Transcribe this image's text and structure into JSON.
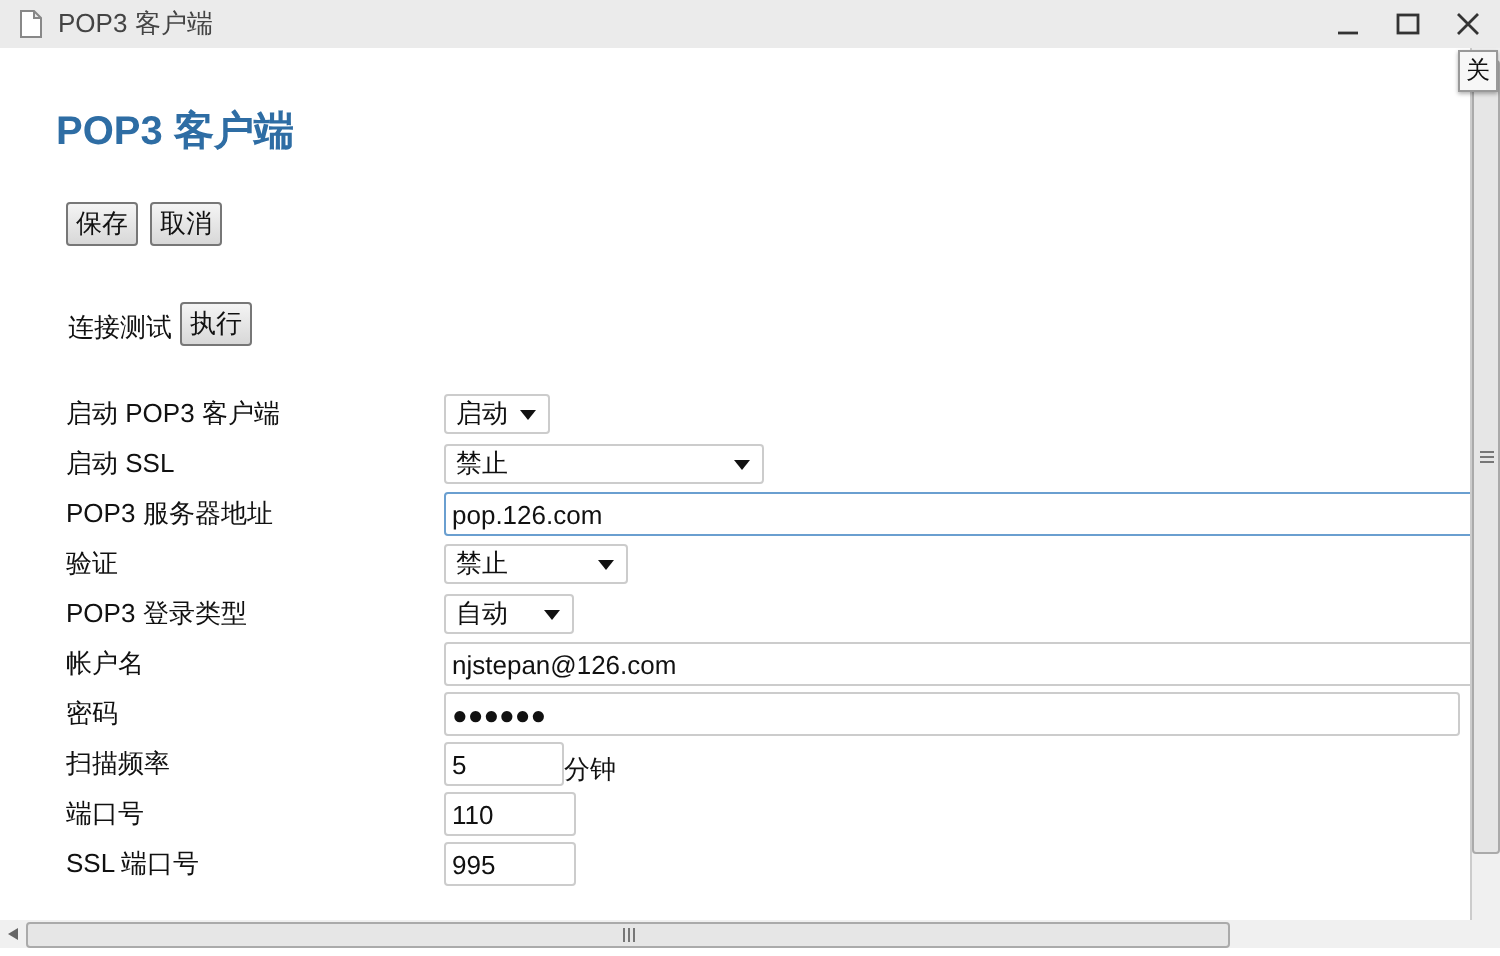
{
  "window": {
    "title": "POP3 客户端",
    "tooltip": "关"
  },
  "heading": "POP3 客户端",
  "buttons": [
    "保存",
    "取消"
  ],
  "connection_test": {
    "label": "连接测试",
    "button": "执行"
  },
  "fields": [
    {
      "label": "启动 POP3 客户端",
      "kind": "select",
      "value": "启动"
    },
    {
      "label": "启动 SSL",
      "kind": "select",
      "value": "禁止"
    },
    {
      "label": "POP3 服务器地址",
      "kind": "text",
      "value": "pop.126.com"
    },
    {
      "label": "验证",
      "kind": "select",
      "value": "禁止"
    },
    {
      "label": "POP3 登录类型",
      "kind": "select",
      "value": "自动"
    },
    {
      "label": "帐户名",
      "kind": "text",
      "value": "njstepan@126.com"
    },
    {
      "label": "密码",
      "kind": "text",
      "value": "●●●●●●"
    },
    {
      "label": "扫描频率",
      "kind": "text",
      "value": "5",
      "unit": "分钟"
    },
    {
      "label": "端口号",
      "kind": "text",
      "value": "110"
    },
    {
      "label": "SSL 端口号",
      "kind": "text",
      "value": "995"
    }
  ]
}
